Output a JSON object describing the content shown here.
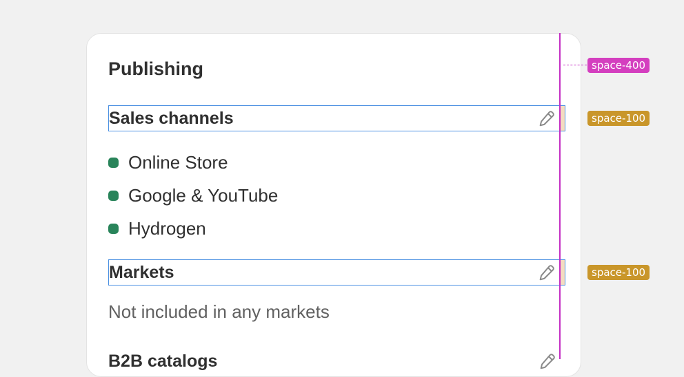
{
  "card": {
    "title": "Publishing",
    "sales_channels": {
      "label": "Sales channels",
      "items": [
        {
          "label": "Online Store",
          "status_color": "#29845a"
        },
        {
          "label": "Google & YouTube",
          "status_color": "#29845a"
        },
        {
          "label": "Hydrogen",
          "status_color": "#29845a"
        }
      ]
    },
    "markets": {
      "label": "Markets",
      "text": "Not included in any markets"
    },
    "b2b": {
      "label": "B2B catalogs"
    },
    "edit_icon": "pencil-icon"
  },
  "annotations": {
    "outer_spacing": "space-400",
    "sales_channels_spacing": "space-100",
    "markets_spacing": "space-100"
  },
  "colors": {
    "guide": "#c42ec4",
    "selection": "#4a90e2",
    "badge_pink": "#d43fbf",
    "badge_gold": "#c9962a",
    "status_success": "#29845a"
  }
}
